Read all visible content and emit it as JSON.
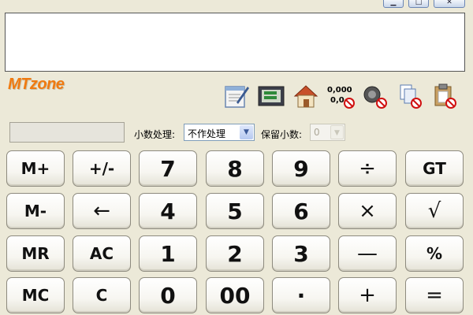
{
  "brand": {
    "logo_text": "MTzone",
    "accent": "#f07a10"
  },
  "window_controls": [
    "minimize-icon",
    "maximize-icon",
    "close-icon"
  ],
  "display": {
    "value": ""
  },
  "toolbar_icons": [
    "notepad-icon",
    "history-icon",
    "home-icon",
    "thousands-separator-off-icon",
    "sound-off-icon",
    "copy-off-icon",
    "paste-off-icon"
  ],
  "thousands_icon_text": {
    "top": "0,000",
    "bottom": "0,0"
  },
  "options": {
    "decimal_label": "小数处理:",
    "decimal_mode": "不作处理",
    "places_label": "保留小数:",
    "places_value": "0"
  },
  "keys": {
    "m_plus": "M+",
    "sign": "+/-",
    "d7": "7",
    "d8": "8",
    "d9": "9",
    "div": "÷",
    "gt": "GT",
    "m_minus": "M-",
    "back": "←",
    "d4": "4",
    "d5": "5",
    "d6": "6",
    "mul": "×",
    "sqrt": "√",
    "mr": "MR",
    "ac": "AC",
    "d1": "1",
    "d2": "2",
    "d3": "3",
    "minus": "—",
    "pct": "%",
    "mc": "MC",
    "c": "C",
    "d0": "0",
    "d00": "00",
    "dot": "·",
    "plus": "+",
    "eq": "="
  }
}
